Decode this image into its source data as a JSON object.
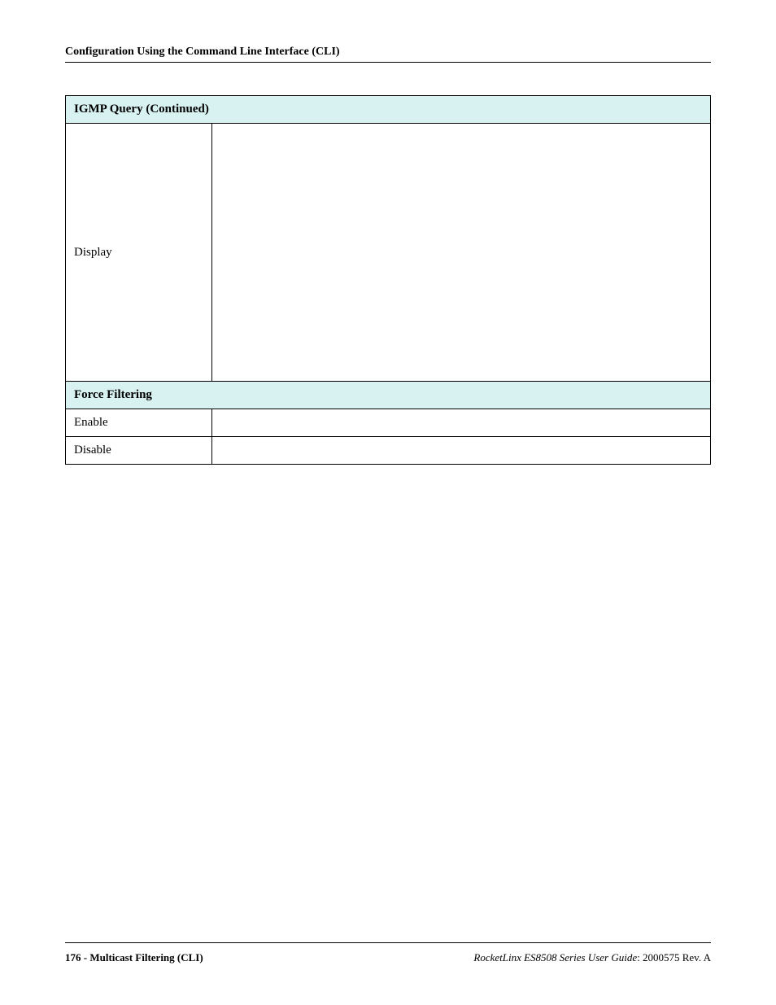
{
  "header": {
    "title": "Configuration Using the Command Line Interface (CLI)"
  },
  "table": {
    "section1": {
      "title": "IGMP Query (Continued)"
    },
    "row_display": {
      "label": "Display"
    },
    "section2": {
      "title": "Force Filtering"
    },
    "row_enable": {
      "label": "Enable"
    },
    "row_disable": {
      "label": "Disable"
    }
  },
  "footer": {
    "page_number": "176",
    "left_suffix": " - Multicast Filtering (CLI)",
    "product_italic": "RocketLinx ES8508 Series  User Guide",
    "doc_rev": ": 2000575 Rev. A"
  }
}
